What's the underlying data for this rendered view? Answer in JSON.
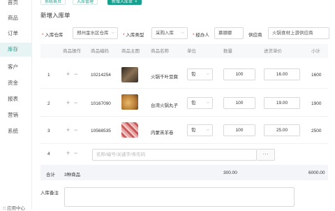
{
  "sidebar": {
    "items": [
      {
        "label": "首页"
      },
      {
        "label": "商品"
      },
      {
        "label": "订单"
      },
      {
        "label": "库存",
        "active": true
      },
      {
        "label": "客户"
      },
      {
        "label": "资金"
      },
      {
        "label": "报表"
      },
      {
        "label": "营销"
      },
      {
        "label": "系统"
      }
    ],
    "footer": "应用中心"
  },
  "breadcrumbs": [
    "系统首页",
    "入库管理",
    "新增入库单"
  ],
  "page_title": "新增入库单",
  "form": {
    "warehouse_label": "入库仓库",
    "warehouse_value": "郑州金水区仓库",
    "type_label": "入库类型",
    "type_value": "采购入库",
    "operator_label": "经办人",
    "operator_value": "慕娜娜",
    "supplier_label": "供应商",
    "supplier_value": "火锅食材上游供应商"
  },
  "table": {
    "headers": [
      "商品操作",
      "商品编码",
      "商品主图",
      "商品名称",
      "单位",
      "数量",
      "进货单价",
      "小计"
    ],
    "rows": [
      {
        "index": "1",
        "code": "10214254",
        "name": "火锅千叶豆腐",
        "unit": "包",
        "qty": "100",
        "price": "16.00",
        "subtotal": "1600",
        "thumb_color": "#5a4a3a"
      },
      {
        "index": "2",
        "code": "10167090",
        "name": "台湾火锅丸子",
        "unit": "包",
        "qty": "100",
        "price": "19.00",
        "subtotal": "1900",
        "thumb_color": "#d9a55e"
      },
      {
        "index": "3",
        "code": "10568535",
        "name": "内蒙羔羊卷",
        "unit": "包",
        "qty": "100",
        "price": "25.00",
        "subtotal": "2500",
        "thumb_color": "#d98a8a"
      }
    ],
    "new_row_index": "4",
    "search_placeholder": "名称/编号/关键字/条形码",
    "search_button": "···"
  },
  "totals": {
    "label": "合计",
    "items": "3种商品",
    "qty": "300.00",
    "amount": "6000.00"
  },
  "remark_label": "入库备注",
  "colors": {
    "accent": "#17a08e"
  }
}
